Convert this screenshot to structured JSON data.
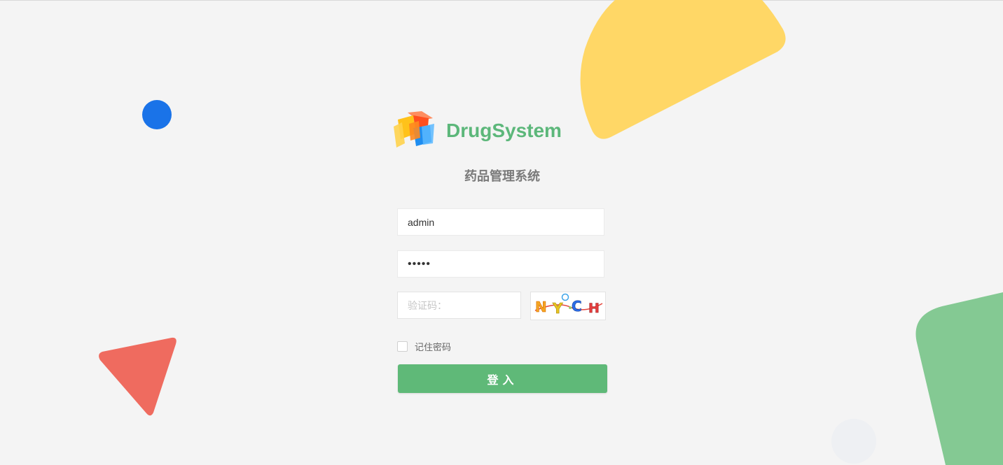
{
  "brand": {
    "name": "DrugSystem",
    "subtitle": "药品管理系统"
  },
  "form": {
    "username_value": "admin",
    "password_value": "•••••",
    "captcha_placeholder": "验证码：",
    "captcha_text": "NYCH",
    "remember_label": "记住密码",
    "remember_checked": false,
    "submit_label": "登入"
  },
  "colors": {
    "background": "#f4f4f4",
    "brand_green": "#5cb77a",
    "button_green": "#5fb978",
    "yellow_shape": "#ffd766",
    "blue_dot": "#1a73e8",
    "red_triangle": "#ef6b5f",
    "green_shape": "#84c993"
  }
}
